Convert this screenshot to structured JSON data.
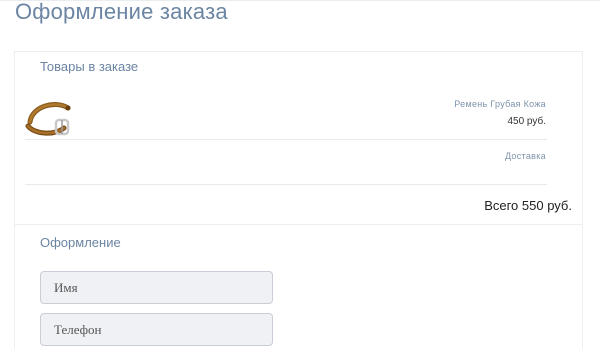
{
  "page": {
    "title": "Оформление заказа"
  },
  "cart": {
    "title": "Товары в заказе",
    "items": [
      {
        "name": "Ремень Грубая Кожа",
        "price": "450 руб.",
        "image_icon": "leather-belt-thumbnail"
      }
    ],
    "delivery_label": "Доставка",
    "total": "Всего 550 руб."
  },
  "checkout": {
    "title": "Оформление",
    "fields": {
      "name_placeholder": "Имя",
      "name_value": "",
      "phone_placeholder": "Телефон",
      "phone_value": ""
    }
  },
  "colors": {
    "heading": "#6b85a3",
    "muted_label": "#7e94ab",
    "field_bg": "#eff1f5",
    "field_border": "#c9ced6"
  }
}
